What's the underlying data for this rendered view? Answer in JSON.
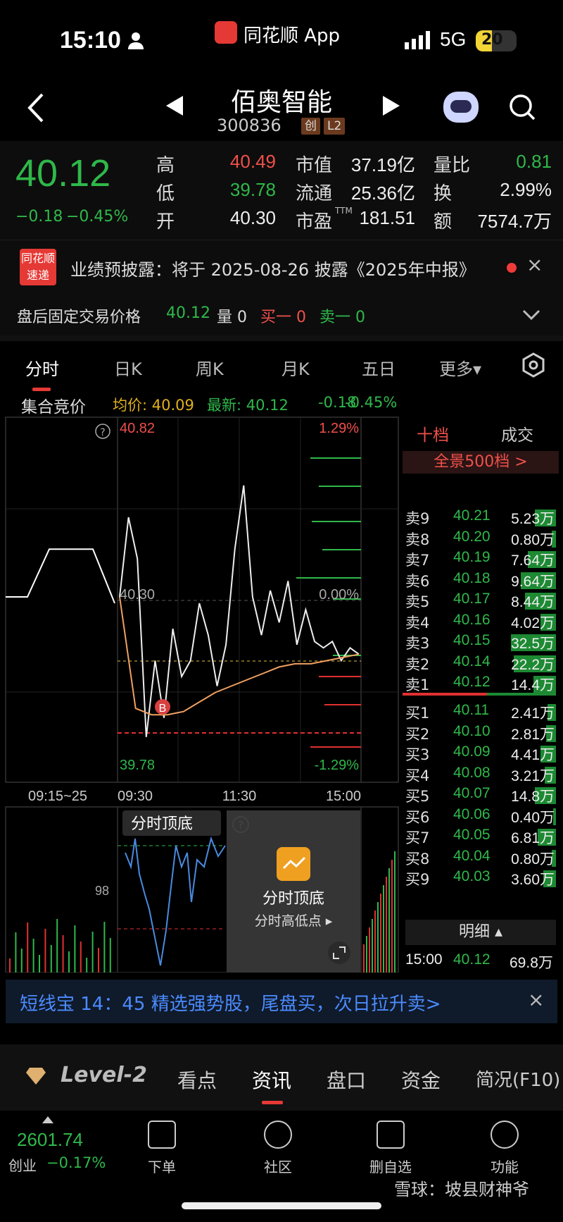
{
  "status": {
    "time": "15:10",
    "app": "同花顺 App",
    "network": "5G",
    "battery": "20"
  },
  "header": {
    "name": "佰奥智能",
    "code": "300836",
    "tag1": "创",
    "tag2": "L2"
  },
  "quote": {
    "price": "40.12",
    "change": "−0.18",
    "change_pct": "−0.45%",
    "high_label": "高",
    "high": "40.49",
    "low_label": "低",
    "low": "39.78",
    "open_label": "开",
    "open": "40.30",
    "mcap_label": "市值",
    "mcap": "37.19亿",
    "float_label": "流通",
    "float": "25.36亿",
    "pe_label": "市盈",
    "pe_sup": "TTM",
    "pe": "181.51",
    "vr_label": "量比",
    "vr": "0.81",
    "turn_label": "换",
    "turn": "2.99%",
    "amt_label": "额",
    "amt": "7574.7万"
  },
  "notice": {
    "logo_top": "同花顺",
    "logo_bottom": "速递",
    "text": "业绩预披露：将于 2025-08-26 披露《2025年中报》",
    "close": "×"
  },
  "fixed": {
    "label": "盘后固定交易价格",
    "price": "40.12",
    "vol_label": "量 0",
    "buy": "买一 0",
    "sell": "卖一 0"
  },
  "tabs": [
    "分时",
    "日K",
    "周K",
    "月K",
    "五日",
    "更多▾"
  ],
  "info": {
    "auction": "集合竞价",
    "avg": "均价: 40.09",
    "latest": "最新: 40.12",
    "chg": "-0.18",
    "pct": "-0.45%"
  },
  "chart_data": {
    "type": "line",
    "title": "",
    "ylim": [
      39.78,
      40.82
    ],
    "y_top_label": "40.82",
    "y_mid_label": "40.30",
    "y_bottom_label": "39.78",
    "pct_top": "1.29%",
    "pct_mid": "0.00%",
    "pct_bottom": "-1.29%",
    "x_ticks": [
      "09:15~25",
      "09:30",
      "11:30",
      "15:00"
    ],
    "series": [
      {
        "values": [
          40.3,
          40.55,
          40.42,
          39.86,
          40.1,
          39.92,
          40.2,
          40.05,
          40.1,
          40.28,
          40.18,
          40.02,
          40.15,
          40.45,
          40.65,
          40.3,
          40.18,
          40.32,
          40.22,
          40.35,
          40.15,
          40.26,
          40.16,
          40.14,
          40.16,
          40.1,
          40.14,
          40.12
        ]
      },
      {
        "values": [
          40.3,
          39.95,
          39.93,
          39.93,
          39.94,
          39.97,
          40.0,
          40.02,
          40.04,
          40.06,
          40.08,
          40.09,
          40.09,
          40.1,
          40.11,
          40.12
        ]
      }
    ],
    "auction_values": [
      40.3,
      40.3,
      40.45,
      40.45,
      40.45,
      40.28
    ]
  },
  "indicator": {
    "title": "分时顶底",
    "level": "98",
    "popup_title": "分时顶底",
    "popup_sub": "分时高低点 ▸"
  },
  "ladder": {
    "tabs": [
      "十档",
      "成交"
    ],
    "full": "全景500档 >",
    "sells": [
      {
        "label": "卖9",
        "price": "40.21",
        "vol": "5.23万",
        "w": 30
      },
      {
        "label": "卖8",
        "price": "40.20",
        "vol": "0.80万",
        "w": 6
      },
      {
        "label": "卖7",
        "price": "40.19",
        "vol": "7.64万",
        "w": 40
      },
      {
        "label": "卖6",
        "price": "40.18",
        "vol": "9.64万",
        "w": 50
      },
      {
        "label": "卖5",
        "price": "40.17",
        "vol": "8.44万",
        "w": 44
      },
      {
        "label": "卖4",
        "price": "40.16",
        "vol": "4.02万",
        "w": 22
      },
      {
        "label": "卖3",
        "price": "40.15",
        "vol": "32.5万",
        "w": 64
      },
      {
        "label": "卖2",
        "price": "40.14",
        "vol": "22.2万",
        "w": 60
      },
      {
        "label": "卖1",
        "price": "40.12",
        "vol": "14.4万",
        "w": 32
      }
    ],
    "buys": [
      {
        "label": "买1",
        "price": "40.11",
        "vol": "2.41万",
        "w": 12
      },
      {
        "label": "买2",
        "price": "40.10",
        "vol": "2.81万",
        "w": 14
      },
      {
        "label": "买3",
        "price": "40.09",
        "vol": "4.41万",
        "w": 22
      },
      {
        "label": "买4",
        "price": "40.08",
        "vol": "3.21万",
        "w": 16
      },
      {
        "label": "买5",
        "price": "40.07",
        "vol": "14.8万",
        "w": 30
      },
      {
        "label": "买6",
        "price": "40.06",
        "vol": "0.40万",
        "w": 4
      },
      {
        "label": "买7",
        "price": "40.05",
        "vol": "6.81万",
        "w": 26
      },
      {
        "label": "买8",
        "price": "40.04",
        "vol": "0.80万",
        "w": 6
      },
      {
        "label": "买9",
        "price": "40.03",
        "vol": "3.60万",
        "w": 18
      }
    ],
    "detail_label": "明细 ▴",
    "last_time": "15:00",
    "last_price": "40.12",
    "last_vol": "69.8万"
  },
  "banner": {
    "text": "短线宝 14：45 精选强势股，尾盘买，次日拉升卖>",
    "close": "×"
  },
  "bnav": [
    "Level-2",
    "看点",
    "资讯",
    "盘口",
    "资金",
    "简况(F10)"
  ],
  "toolbar": {
    "index": "2601.74",
    "index_name": "创业",
    "index_chg": "−0.17%",
    "items": [
      "下单",
      "社区",
      "删自选",
      "功能"
    ]
  },
  "watermark": "雪球：坡县财神爷"
}
